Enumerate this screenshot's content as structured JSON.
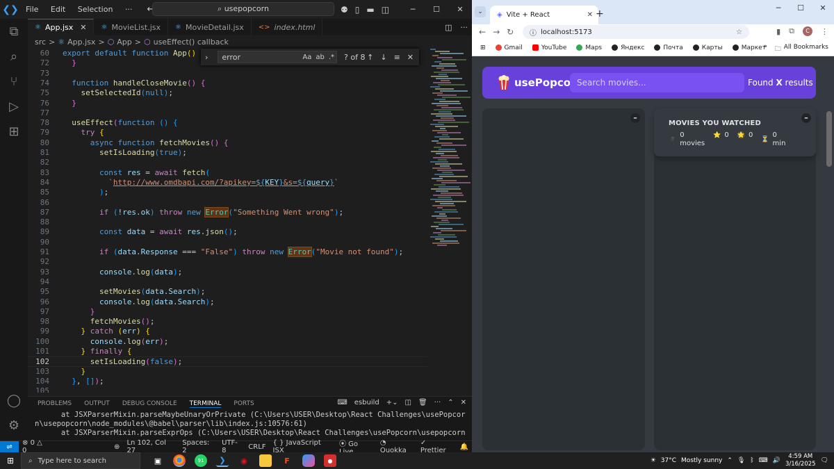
{
  "vscode": {
    "menu": [
      "File",
      "Edit",
      "Selection",
      "···"
    ],
    "command_center": "usepopcorn",
    "tabs": [
      {
        "name": "App.jsx",
        "icon": "react-icon",
        "active": true
      },
      {
        "name": "MovieList.jsx",
        "icon": "react-icon",
        "active": false
      },
      {
        "name": "MovieDetail.jsx",
        "icon": "react-icon",
        "active": false
      },
      {
        "name": "index.html",
        "icon": "html-icon",
        "active": false
      }
    ],
    "breadcrumb": [
      "src",
      ">",
      "App.jsx",
      ">",
      "App",
      ">",
      "useEffect() callback"
    ],
    "find": {
      "query": "error",
      "count": "? of 8",
      "opt_case": "Aa",
      "opt_word": "ab",
      "opt_regex": ".*"
    },
    "code": [
      {
        "n": "60",
        "html": "<span class='kw'>export</span> <span class='kw'>default</span> <span class='kw'>function</span> <span class='fn'>App</span><span class='br'>()</span> <span class='br'>{</span>"
      },
      {
        "n": "72",
        "html": "  <span class='br2'>}</span>"
      },
      {
        "n": "73",
        "html": ""
      },
      {
        "n": "74",
        "html": "  <span class='kw'>function</span> <span class='fn'>handleCloseMovie</span><span class='br2'>()</span> <span class='br2'>{</span>"
      },
      {
        "n": "75",
        "html": "    <span class='fn'>setSelectedId</span><span class='br3'>(</span><span class='kw'>null</span><span class='br3'>)</span><span class='pn'>;</span>"
      },
      {
        "n": "76",
        "html": "  <span class='br2'>}</span>"
      },
      {
        "n": "77",
        "html": ""
      },
      {
        "n": "78",
        "html": "  <span class='fn'>useEffect</span><span class='br2'>(</span><span class='kw'>function</span> <span class='br3'>()</span> <span class='br3'>{</span>"
      },
      {
        "n": "79",
        "html": "    <span class='kw2'>try</span> <span class='br'>{</span>"
      },
      {
        "n": "80",
        "html": "      <span class='kw'>async</span> <span class='kw'>function</span> <span class='fn'>fetchMovies</span><span class='br2'>()</span> <span class='br2'>{</span>"
      },
      {
        "n": "81",
        "html": "        <span class='fn'>setIsLoading</span><span class='br3'>(</span><span class='kw'>true</span><span class='br3'>)</span><span class='pn'>;</span>"
      },
      {
        "n": "82",
        "html": ""
      },
      {
        "n": "83",
        "html": "        <span class='kw'>const</span> <span class='vr'>res</span> <span class='pn'>=</span> <span class='kw2'>await</span> <span class='fn'>fetch</span><span class='br3'>(</span>"
      },
      {
        "n": "84",
        "html": "          <span class='st'>`</span><span class='url'>http://www.omdbapi.com/?apikey=<span class='tpl'>${</span><span class='vr'>KEY</span><span class='tpl'>}</span>&amp;s=<span class='tpl'>${</span><span class='vr'>query</span><span class='tpl'>}</span></span><span class='st'>`</span>"
      },
      {
        "n": "85",
        "html": "        <span class='br3'>)</span><span class='pn'>;</span>"
      },
      {
        "n": "86",
        "html": ""
      },
      {
        "n": "87",
        "html": "        <span class='kw2'>if</span> <span class='br3'>(</span><span class='pn'>!</span><span class='vr'>res</span><span class='pn'>.</span><span class='vr'>ok</span><span class='br3'>)</span> <span class='kw2'>throw</span> <span class='kw'>new</span> <span class='hl'>Error</span><span class='br3'>(</span><span class='st'>\"Something Went wrong\"</span><span class='br3'>)</span><span class='pn'>;</span>"
      },
      {
        "n": "88",
        "html": ""
      },
      {
        "n": "89",
        "html": "        <span class='kw'>const</span> <span class='vr'>data</span> <span class='pn'>=</span> <span class='kw2'>await</span> <span class='vr'>res</span><span class='pn'>.</span><span class='fn'>json</span><span class='br3'>()</span><span class='pn'>;</span>"
      },
      {
        "n": "90",
        "html": ""
      },
      {
        "n": "91",
        "html": "        <span class='kw2'>if</span> <span class='br3'>(</span><span class='vr'>data</span><span class='pn'>.</span><span class='vr'>Response</span> <span class='pn'>===</span> <span class='st'>\"False\"</span><span class='br3'>)</span> <span class='kw2'>throw</span> <span class='kw'>new</span> <span class='hl'>Error</span><span class='br3'>(</span><span class='st'>\"Movie not found\"</span><span class='br3'>)</span><span class='pn'>;</span>"
      },
      {
        "n": "92",
        "html": ""
      },
      {
        "n": "93",
        "html": "        <span class='vr'>console</span><span class='pn'>.</span><span class='fn'>log</span><span class='br3'>(</span><span class='vr'>data</span><span class='br3'>)</span><span class='pn'>;</span>"
      },
      {
        "n": "94",
        "html": ""
      },
      {
        "n": "95",
        "html": "        <span class='fn'>setMovies</span><span class='br3'>(</span><span class='vr'>data</span><span class='pn'>.</span><span class='vr'>Search</span><span class='br3'>)</span><span class='pn'>;</span>"
      },
      {
        "n": "96",
        "html": "        <span class='vr'>console</span><span class='pn'>.</span><span class='fn'>log</span><span class='br3'>(</span><span class='vr'>data</span><span class='pn'>.</span><span class='vr'>Search</span><span class='br3'>)</span><span class='pn'>;</span>"
      },
      {
        "n": "97",
        "html": "      <span class='br2'>}</span>"
      },
      {
        "n": "98",
        "html": "      <span class='fn'>fetchMovies</span><span class='br2'>()</span><span class='pn'>;</span>"
      },
      {
        "n": "99",
        "html": "    <span class='br'>}</span> <span class='kw2'>catch</span> <span class='br'>(</span><span class='vr'>err</span><span class='br'>)</span> <span class='br'>{</span>"
      },
      {
        "n": "100",
        "html": "      <span class='vr'>console</span><span class='pn'>.</span><span class='fn'>log</span><span class='br2'>(</span><span class='vr'>err</span><span class='br2'>)</span><span class='pn'>;</span>"
      },
      {
        "n": "101",
        "html": "    <span class='br'>}</span> <span class='kw2'>finally</span> <span class='br'>{</span>"
      },
      {
        "n": "102",
        "html": "      <span class='fn'>setIsLoading</span><span class='br2'>(</span><span class='kw'>false</span><span class='br2'>)</span><span class='pn'>;</span>",
        "current": true
      },
      {
        "n": "103",
        "html": "    <span class='br'>}</span>"
      },
      {
        "n": "104",
        "html": "  <span class='br3'>}</span><span class='pn'>,</span> <span class='br3'>[]</span><span class='br2'>)</span><span class='pn'>;</span>"
      },
      {
        "n": "105",
        "html": ""
      }
    ],
    "panel_tabs": [
      "PROBLEMS",
      "OUTPUT",
      "DEBUG CONSOLE",
      "TERMINAL",
      "PORTS"
    ],
    "panel_active": "TERMINAL",
    "terminal_name": "esbuild",
    "terminal_lines": [
      "      at JSXParserMixin.parseMaybeUnaryOrPrivate (C:\\Users\\USER\\Desktop\\React Challenges\\usePopcor",
      "n\\usepopcorn\\node_modules\\@babel\\parser\\lib\\index.js:10576:61)",
      "      at JSXParserMixin.parseExprOps (C:\\Users\\USER\\Desktop\\React Challenges\\usePopcorn\\usepopcorn"
    ],
    "status": {
      "errors": "0",
      "warnings": "0",
      "position": "Ln 102, Col 27",
      "spaces": "Spaces: 2",
      "encoding": "UTF-8",
      "eol": "CRLF",
      "language": "JavaScript JSX",
      "golive": "Go Live",
      "quokka": "Quokka",
      "prettier": "Prettier"
    }
  },
  "browser": {
    "tab_title": "Vite + React",
    "url": "localhost:5173",
    "bookmarks": [
      {
        "label": "Gmail",
        "color": "#ea4335"
      },
      {
        "label": "YouTube",
        "color": "#ff0000"
      },
      {
        "label": "Maps",
        "color": "#34a853"
      },
      {
        "label": "Яндекс",
        "color": "#222222"
      },
      {
        "label": "Почта",
        "color": "#222222"
      },
      {
        "label": "Карты",
        "color": "#222222"
      },
      {
        "label": "Маркет",
        "color": "#222222"
      }
    ],
    "all_bookmarks": "All Bookmarks",
    "more": "»"
  },
  "app": {
    "brand": "usePopcorn",
    "search_placeholder": "Search movies...",
    "found_prefix": "Found ",
    "found_count": "X",
    "found_suffix": " results",
    "toggle": "–",
    "summary_title": "MOVIES YOU WATCHED",
    "stats": [
      {
        "icon": "hash-icon",
        "glyph": "#️",
        "value": "0",
        "unit": "movies"
      },
      {
        "icon": "star-icon",
        "glyph": "⭐",
        "value": "0",
        "unit": ""
      },
      {
        "icon": "star-icon",
        "glyph": "🌟",
        "value": "0",
        "unit": ""
      },
      {
        "icon": "hourglass-icon",
        "glyph": "⏳",
        "value": "0",
        "unit": "min"
      }
    ],
    "colors": {
      "primary": "#6741d9",
      "primary_light": "#7950f2",
      "background": "#343a40",
      "box": "#2b3035"
    }
  },
  "taskbar": {
    "search_placeholder": "Type here to search",
    "temperature": "37°C",
    "weather": "Mostly sunny",
    "time": "4:59 AM",
    "date": "3/16/2025",
    "badge": "91"
  }
}
